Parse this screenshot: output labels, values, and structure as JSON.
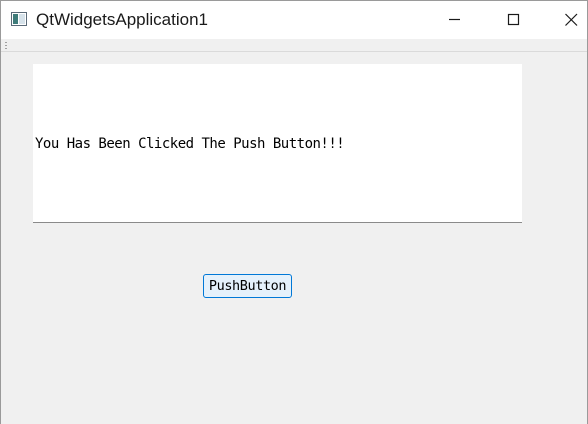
{
  "window": {
    "title": "QtWidgetsApplication1",
    "icon": "app-window-icon",
    "controls": {
      "minimize_icon": "minimize-icon",
      "maximize_icon": "maximize-icon",
      "close_icon": "close-icon"
    }
  },
  "main": {
    "display_text": "You Has Been Clicked The Push Button!!!",
    "push_button_label": "PushButton"
  },
  "colors": {
    "window_background": "#f0f0f0",
    "titlebar_background": "#ffffff",
    "display_background": "#ffffff",
    "button_background": "#e5f1fb",
    "button_border": "#0078d7"
  }
}
